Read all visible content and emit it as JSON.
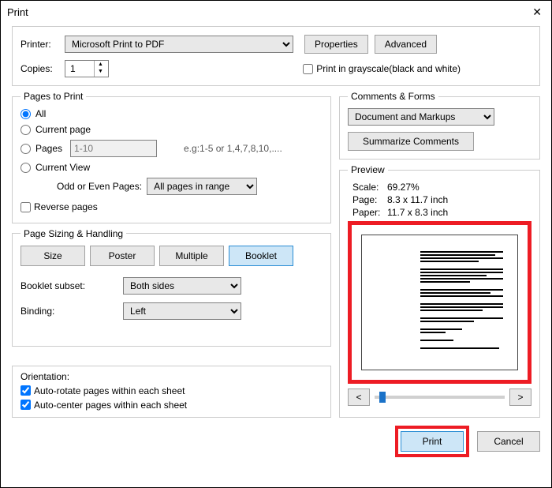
{
  "window": {
    "title": "Print"
  },
  "top": {
    "printer_label": "Printer:",
    "printer_value": "Microsoft Print to PDF",
    "properties": "Properties",
    "advanced": "Advanced",
    "copies_label": "Copies:",
    "copies_value": "1",
    "grayscale": "Print in grayscale(black and white)"
  },
  "pages": {
    "legend": "Pages to Print",
    "all": "All",
    "current": "Current page",
    "pages_label": "Pages",
    "pages_placeholder": "1-10",
    "pages_hint": "e.g:1-5 or 1,4,7,8,10,....",
    "current_view": "Current View",
    "odd_even_label": "Odd or Even Pages:",
    "odd_even_value": "All pages in range",
    "reverse": "Reverse pages"
  },
  "sizing": {
    "legend": "Page Sizing & Handling",
    "size": "Size",
    "poster": "Poster",
    "multiple": "Multiple",
    "booklet": "Booklet",
    "subset_label": "Booklet subset:",
    "subset_value": "Both sides",
    "binding_label": "Binding:",
    "binding_value": "Left"
  },
  "orientation": {
    "legend": "Orientation:",
    "auto_rotate": "Auto-rotate pages within each sheet",
    "auto_center": "Auto-center pages within each sheet"
  },
  "comments": {
    "legend": "Comments & Forms",
    "value": "Document and Markups",
    "summarize": "Summarize Comments"
  },
  "preview": {
    "legend": "Preview",
    "scale_label": "Scale:",
    "scale_value": "69.27%",
    "page_label": "Page:",
    "page_value": "8.3 x 11.7 inch",
    "paper_label": "Paper:",
    "paper_value": "11.7 x 8.3 inch",
    "prev": "<",
    "next": ">"
  },
  "footer": {
    "print": "Print",
    "cancel": "Cancel"
  }
}
